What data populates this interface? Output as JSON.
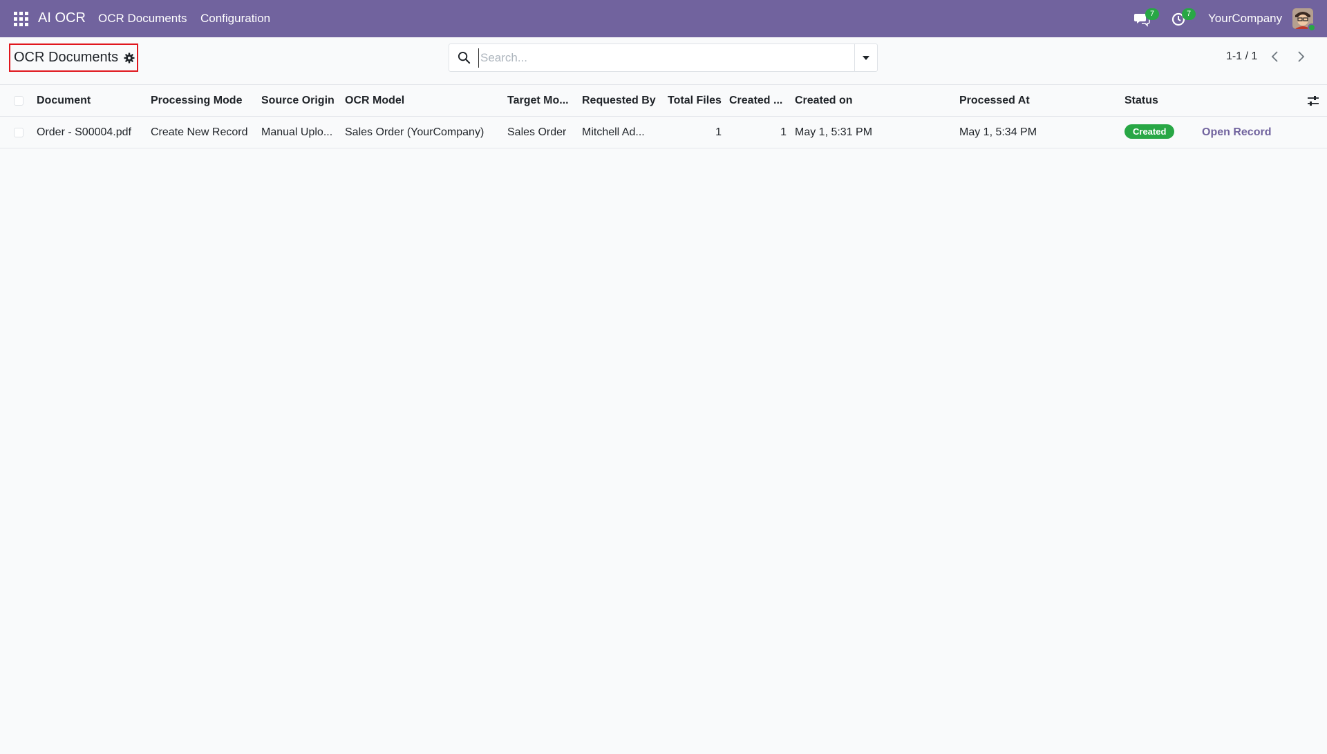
{
  "navbar": {
    "app_name": "AI OCR",
    "menu": [
      "OCR Documents",
      "Configuration"
    ],
    "chat_count": "7",
    "activity_count": "7",
    "company": "YourCompany"
  },
  "control_panel": {
    "title": "OCR Documents",
    "search_placeholder": "Search...",
    "pager": "1-1 / 1"
  },
  "table": {
    "columns": [
      "Document",
      "Processing Mode",
      "Source Origin",
      "OCR Model",
      "Target Mo...",
      "Requested By",
      "Total Files",
      "Created ...",
      "Created on",
      "Processed At",
      "Status"
    ],
    "rows": [
      {
        "document": "Order - S00004.pdf",
        "processing_mode": "Create New Record",
        "source_origin": "Manual Uplo...",
        "ocr_model": "Sales Order (YourCompany)",
        "target_model": "Sales Order",
        "requested_by": "Mitchell Ad...",
        "total_files": "1",
        "created_count": "1",
        "created_on": "May 1, 5:31 PM",
        "processed_at": "May 1, 5:34 PM",
        "status": "Created",
        "action": "Open Record"
      }
    ]
  },
  "colors": {
    "navbar": "#71639e",
    "status_created": "#28a745",
    "link": "#71639e",
    "highlight_border": "#e0161d"
  }
}
